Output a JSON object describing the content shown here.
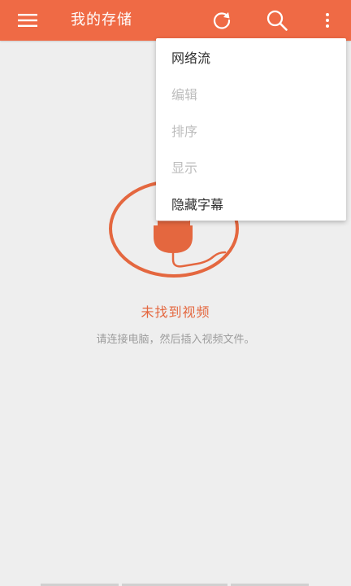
{
  "colors": {
    "accent": "#ef6a45",
    "background": "#eeeeee",
    "empty_title": "#e4673f",
    "empty_subtitle": "#9d9d9d"
  },
  "appbar": {
    "title": "我的存储",
    "icons": [
      "menu-icon",
      "refresh-icon",
      "search-icon",
      "more-vert-icon"
    ]
  },
  "menu": {
    "items": [
      {
        "label": "网络流",
        "enabled": true
      },
      {
        "label": "编辑",
        "enabled": false
      },
      {
        "label": "排序",
        "enabled": false
      },
      {
        "label": "显示",
        "enabled": false
      },
      {
        "label": "隐藏字幕",
        "enabled": true
      }
    ]
  },
  "empty_state": {
    "icon": "unplugged-cable-icon",
    "title": "未找到视频",
    "subtitle": "请连接电脑，然后插入视频文件。"
  }
}
